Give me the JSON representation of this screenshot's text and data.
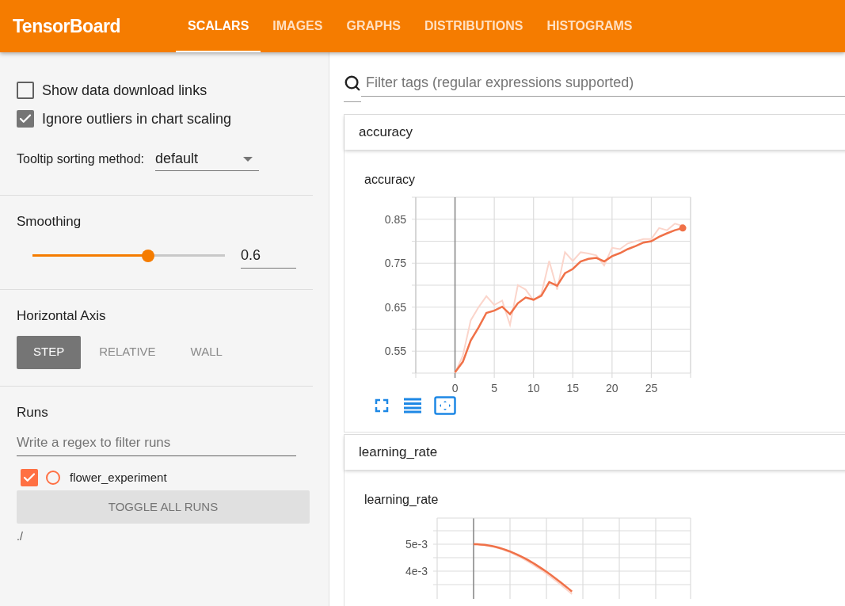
{
  "app": {
    "title": "TensorBoard"
  },
  "tabs": [
    {
      "label": "SCALARS",
      "selected": true
    },
    {
      "label": "IMAGES",
      "selected": false
    },
    {
      "label": "GRAPHS",
      "selected": false
    },
    {
      "label": "DISTRIBUTIONS",
      "selected": false
    },
    {
      "label": "HISTOGRAMS",
      "selected": false
    }
  ],
  "sidebar": {
    "options": [
      {
        "label": "Show data download links",
        "checked": false
      },
      {
        "label": "Ignore outliers in chart scaling",
        "checked": true
      }
    ],
    "tooltip_sorting": {
      "label": "Tooltip sorting method:",
      "value": "default"
    },
    "smoothing": {
      "title": "Smoothing",
      "level": 0.6,
      "value": "0.6"
    },
    "horizontal_axis": {
      "title": "Horizontal Axis",
      "options": [
        {
          "label": "STEP",
          "selected": true
        },
        {
          "label": "RELATIVE",
          "selected": false
        },
        {
          "label": "WALL",
          "selected": false
        }
      ]
    },
    "runs": {
      "title": "Runs",
      "placeholder": "Write a regex to filter runs",
      "items": [
        {
          "name": "flower_experiment",
          "checked": true,
          "color": "#ff7043"
        }
      ],
      "toggle_button": "TOGGLE ALL RUNS",
      "path": "./"
    }
  },
  "filter": {
    "placeholder": "Filter tags (regular expressions supported)"
  },
  "cards": [
    {
      "header": "accuracy",
      "chart_title": "accuracy",
      "chart_data": {
        "type": "line",
        "x": [
          0,
          1,
          2,
          3,
          4,
          5,
          6,
          7,
          8,
          9,
          10,
          11,
          12,
          13,
          14,
          15,
          16,
          17,
          18,
          19,
          20,
          21,
          22,
          23,
          24,
          25,
          26,
          27,
          28,
          29
        ],
        "xlim": [
          -5,
          30
        ],
        "ylim": [
          0.5,
          0.9
        ],
        "xticks": [
          0,
          5,
          10,
          15,
          20,
          25
        ],
        "yticks": [
          0.55,
          0.65,
          0.75,
          0.85
        ],
        "grid": true,
        "series": [
          {
            "color": "#fbd5cb",
            "values": [
              0.5,
              0.54,
              0.62,
              0.65,
              0.675,
              0.655,
              0.665,
              0.61,
              0.7,
              0.69,
              0.665,
              0.68,
              0.755,
              0.69,
              0.775,
              0.755,
              0.775,
              0.772,
              0.768,
              0.745,
              0.785,
              0.782,
              0.795,
              0.8,
              0.805,
              0.805,
              0.83,
              0.825,
              0.84,
              0.835
            ]
          },
          {
            "color": "#f07148",
            "values": [
              0.502,
              0.526,
              0.574,
              0.604,
              0.637,
              0.642,
              0.651,
              0.634,
              0.659,
              0.672,
              0.667,
              0.676,
              0.707,
              0.699,
              0.727,
              0.737,
              0.754,
              0.76,
              0.762,
              0.754,
              0.766,
              0.773,
              0.782,
              0.789,
              0.797,
              0.8,
              0.81,
              0.818,
              0.825,
              0.83
            ]
          }
        ]
      },
      "tools": true
    },
    {
      "header": "learning_rate",
      "chart_title": "learning_rate",
      "y_labels": [
        "5e-3",
        "4e-3"
      ],
      "tools": false
    }
  ]
}
